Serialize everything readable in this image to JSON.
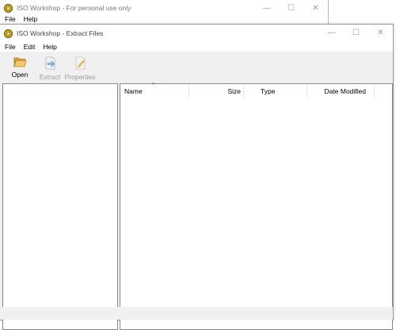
{
  "back_window": {
    "title": "ISO Workshop - For personal use only",
    "menu": [
      "File",
      "Help"
    ],
    "caption": {
      "minimize": "—",
      "maximize": "☐",
      "close": "✕"
    }
  },
  "front_window": {
    "title": "ISO Workshop - Extract Files",
    "menu": [
      "File",
      "Edit",
      "Help"
    ],
    "caption": {
      "minimize": "—",
      "maximize": "☐",
      "close": "✕"
    },
    "toolbar": [
      {
        "label": "Open",
        "icon": "folder-open-icon",
        "enabled": true
      },
      {
        "label": "Extract",
        "icon": "extract-icon",
        "enabled": false
      },
      {
        "label": "Properties",
        "icon": "properties-icon",
        "enabled": false
      }
    ],
    "list": {
      "columns": [
        "Name",
        "Size",
        "Type",
        "Date Modified"
      ],
      "sort_indicator": "^",
      "rows": []
    }
  }
}
